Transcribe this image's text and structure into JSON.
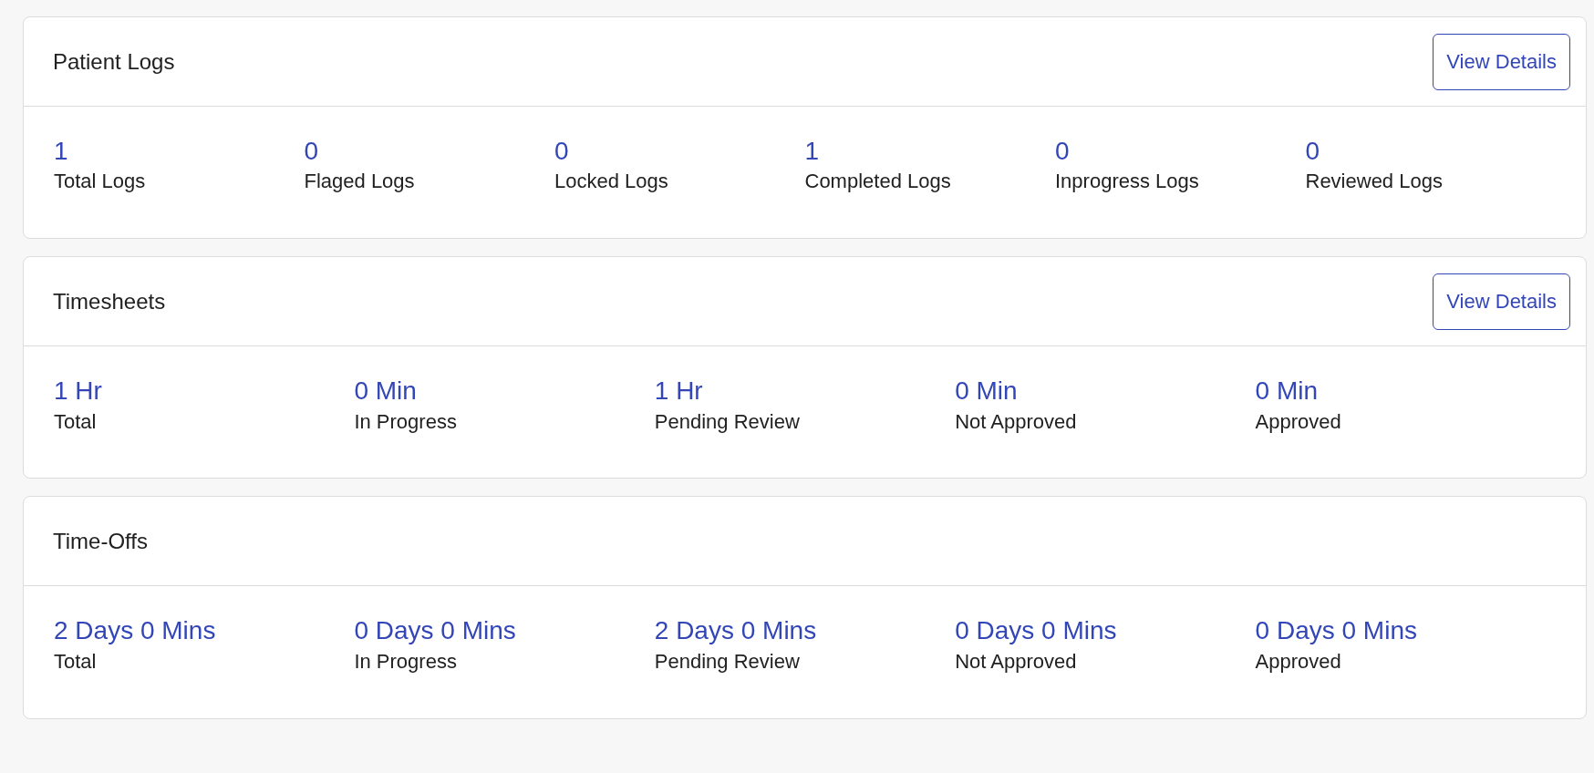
{
  "cards": [
    {
      "title": "Patient Logs",
      "button": "View Details",
      "stats": [
        {
          "value": "1",
          "label": "Total Logs"
        },
        {
          "value": "0",
          "label": "Flaged Logs"
        },
        {
          "value": "0",
          "label": "Locked Logs"
        },
        {
          "value": "1",
          "label": "Completed Logs"
        },
        {
          "value": "0",
          "label": "Inprogress Logs"
        },
        {
          "value": "0",
          "label": "Reviewed Logs"
        }
      ]
    },
    {
      "title": "Timesheets",
      "button": "View Details",
      "stats": [
        {
          "value": "1 Hr",
          "label": "Total"
        },
        {
          "value": "0 Min",
          "label": "In Progress"
        },
        {
          "value": "1 Hr",
          "label": "Pending Review"
        },
        {
          "value": "0 Min",
          "label": "Not Approved"
        },
        {
          "value": "0 Min",
          "label": "Approved"
        }
      ]
    },
    {
      "title": "Time-Offs",
      "stats": [
        {
          "value": "2 Days 0 Mins",
          "label": "Total"
        },
        {
          "value": "0 Days 0 Mins",
          "label": "In Progress"
        },
        {
          "value": "2 Days 0 Mins",
          "label": "Pending Review"
        },
        {
          "value": "0 Days 0 Mins",
          "label": "Not Approved"
        },
        {
          "value": "0 Days 0 Mins",
          "label": "Approved"
        }
      ]
    }
  ]
}
